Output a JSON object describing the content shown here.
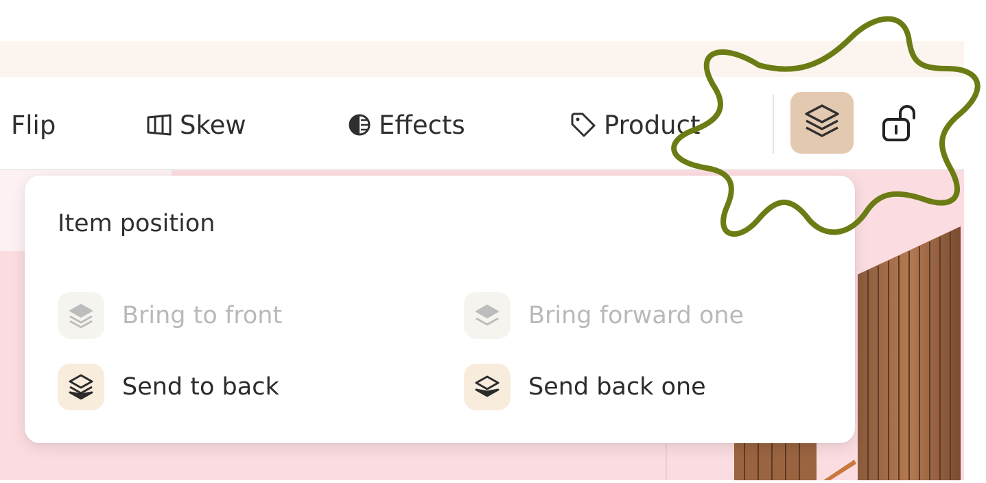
{
  "toolbar": {
    "tools": [
      {
        "label": "Flip",
        "icon": "flip-icon"
      },
      {
        "label": "Skew",
        "icon": "skew-icon"
      },
      {
        "label": "Effects",
        "icon": "effects-icon"
      },
      {
        "label": "Product",
        "icon": "tag-icon"
      }
    ],
    "layers_button": {
      "icon": "layers-icon",
      "active": true
    },
    "lock_button": {
      "icon": "unlocked-padlock-icon"
    }
  },
  "popover": {
    "title": "Item position",
    "options": [
      {
        "label": "Bring to front",
        "enabled": false,
        "icon": "layers-top-icon"
      },
      {
        "label": "Bring forward one",
        "enabled": false,
        "icon": "layers-forward-icon"
      },
      {
        "label": "Send to back",
        "enabled": true,
        "icon": "layers-bottom-icon"
      },
      {
        "label": "Send back one",
        "enabled": true,
        "icon": "layers-backward-icon"
      }
    ]
  },
  "colors": {
    "accent_active_bg": "#e4c9b1",
    "canvas_pink": "#fbdde1",
    "annotation_green": "#6b7c14"
  }
}
